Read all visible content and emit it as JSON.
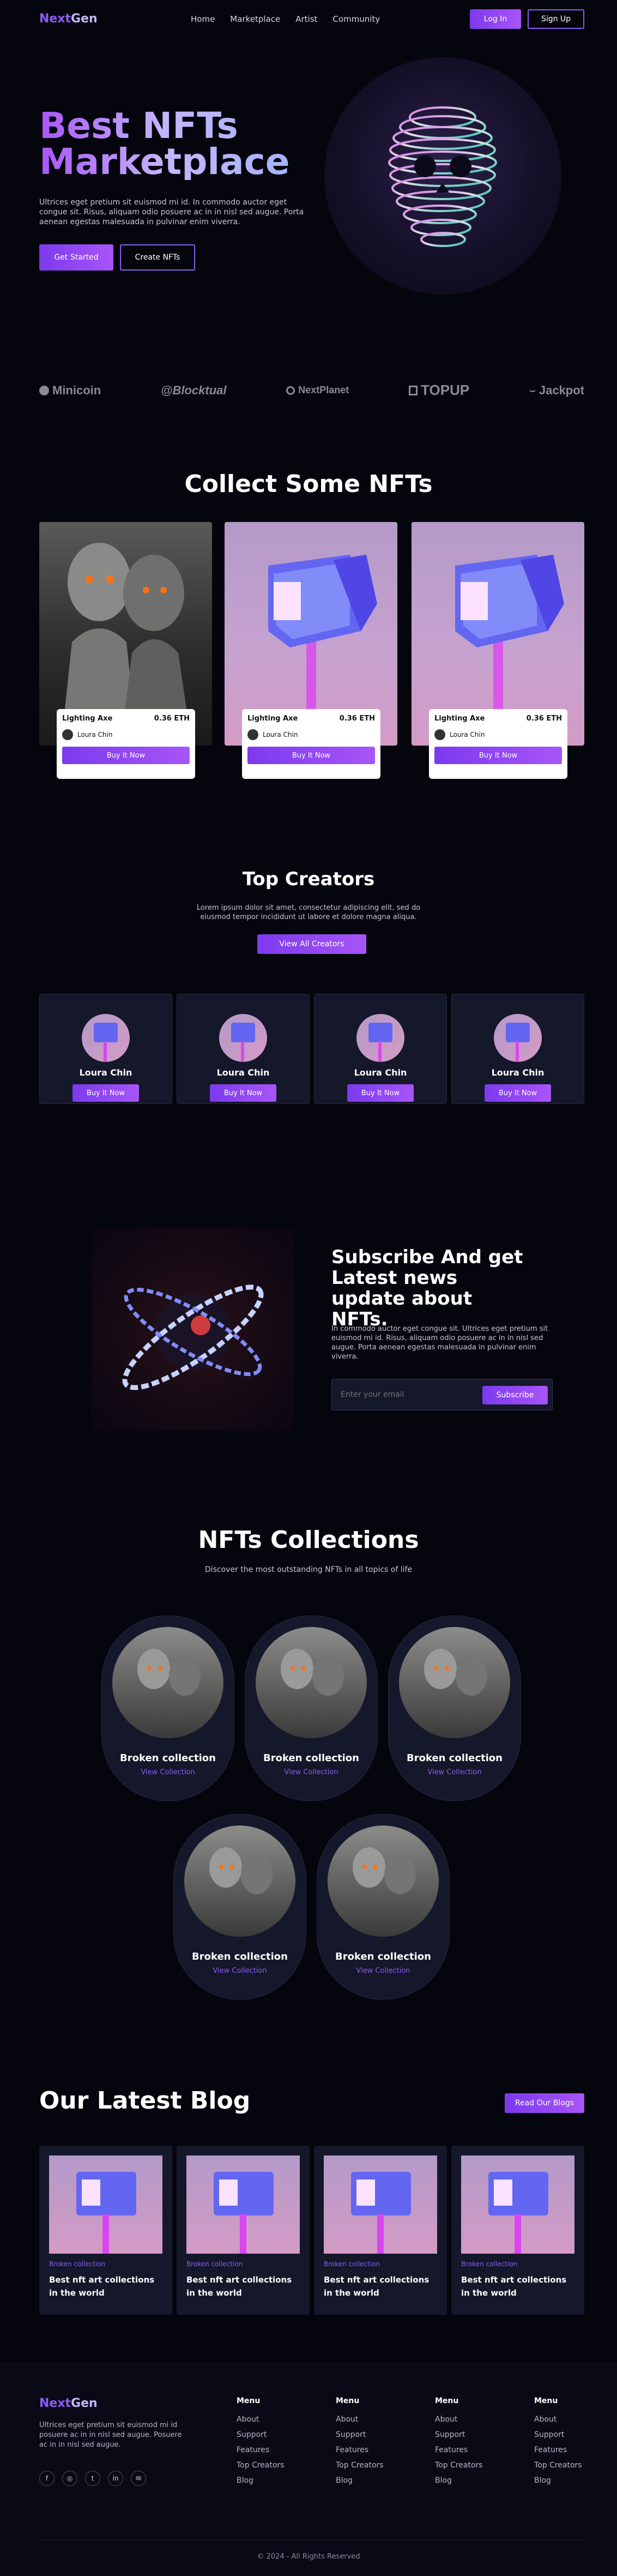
{
  "brand": {
    "name_a": "Next",
    "name_b": "Gen"
  },
  "nav": {
    "links": [
      "Home",
      "Marketplace",
      "Artist",
      "Community"
    ],
    "login": "Log In",
    "signup": "Sign Up"
  },
  "hero": {
    "title_line1": "Best NFTs",
    "title_line2": "Marketplace",
    "body": "Ultrices eget pretium sit euismod mi id. In commodo auctor eget congue sit. Risus, aliquam odio posuere ac in in nisl sed augue. Porta aenean egestas malesuada in pulvinar enim viverra.",
    "primary": "Get Started",
    "secondary": "Create NFTs"
  },
  "partners": [
    "Minicoin",
    "@Blocktual",
    "NextPlanet",
    "TOPUP",
    "Jackpot"
  ],
  "collect": {
    "title": "Collect Some NFTs",
    "cards": [
      {
        "name": "Lighting Axe",
        "price": "0.36 ETH",
        "owner": "Loura Chin",
        "cta": "Buy It Now"
      },
      {
        "name": "Lighting Axe",
        "price": "0.36 ETH",
        "owner": "Loura Chin",
        "cta": "Buy It Now"
      },
      {
        "name": "Lighting Axe",
        "price": "0.36 ETH",
        "owner": "Loura Chin",
        "cta": "Buy It Now"
      }
    ]
  },
  "creators": {
    "title": "Top Creators",
    "body": "Lorem ipsum dolor sit amet, consectetur adipiscing elit, sed do eiusmod tempor incididunt ut labore et dolore magna aliqua.",
    "cta": "View All Creators",
    "items": [
      {
        "name": "Loura Chin",
        "cta": "Buy It Now"
      },
      {
        "name": "Loura Chin",
        "cta": "Buy It Now"
      },
      {
        "name": "Loura Chin",
        "cta": "Buy It Now"
      },
      {
        "name": "Loura Chin",
        "cta": "Buy It Now"
      }
    ]
  },
  "subscribe": {
    "title": "Subscribe And get Latest news update about NFTs.",
    "body": "In commodo auctor eget congue sit. Ultrices eget pretium sit euismod mi id. Risus, aliquam odio posuere ac in in nisl sed augue. Porta aenean egestas malesuada in pulvinar enim viverra.",
    "placeholder": "Enter your email",
    "cta": "Subscribe"
  },
  "collections": {
    "title": "NFTs Collections",
    "subtitle": "Discover the most outstanding NFTs in all topics of life",
    "items": [
      {
        "name": "Broken collection",
        "link": "View Collection"
      },
      {
        "name": "Broken collection",
        "link": "View Collection"
      },
      {
        "name": "Broken collection",
        "link": "View Collection"
      },
      {
        "name": "Broken collection",
        "link": "View Collection"
      },
      {
        "name": "Broken collection",
        "link": "View Collection"
      }
    ]
  },
  "blog": {
    "title": "Our Latest Blog",
    "cta": "Read Our Blogs",
    "posts": [
      {
        "tag": "Broken collection",
        "title": "Best nft art collections in the world"
      },
      {
        "tag": "Broken collection",
        "title": "Best nft art collections in the world"
      },
      {
        "tag": "Broken collection",
        "title": "Best nft art collections in the world"
      },
      {
        "tag": "Broken collection",
        "title": "Best nft art collections in the world"
      }
    ]
  },
  "footer": {
    "body": "Ultrices eget pretium sit euismod mi id posuere ac in in nisl sed augue. Posuere ac in in nisl sed augue.",
    "columns": [
      {
        "head": "Menu",
        "links": [
          "About",
          "Support",
          "Features",
          "Top Creators",
          "Blog"
        ]
      },
      {
        "head": "Menu",
        "links": [
          "About",
          "Support",
          "Features",
          "Top Creators",
          "Blog"
        ]
      },
      {
        "head": "Menu",
        "links": [
          "About",
          "Support",
          "Features",
          "Top Creators",
          "Blog"
        ]
      },
      {
        "head": "Menu",
        "links": [
          "About",
          "Support",
          "Features",
          "Top Creators",
          "Blog"
        ]
      }
    ],
    "copyright": "© 2024 - All Rights Reserved"
  }
}
